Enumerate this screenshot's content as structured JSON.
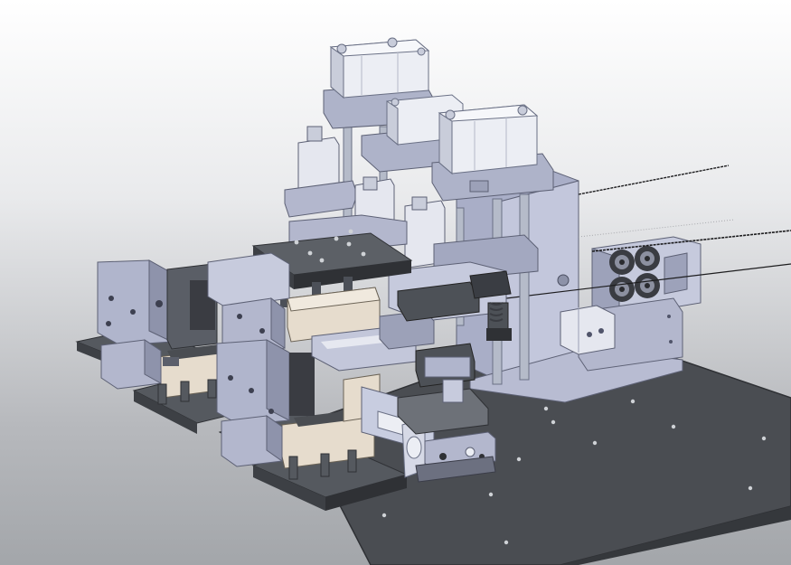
{
  "viewport": {
    "kind": "3d-cad-model-view",
    "background_top": "#ffffff",
    "background_bottom": "#a3a6aa"
  },
  "colors": {
    "base_plate": "#4a4d52",
    "base_plate_edge": "#2f3135",
    "frame_light": "#c9cde0",
    "frame_mid": "#a9aec7",
    "frame_dark": "#7f849c",
    "plate_dark": "#55595f",
    "block_cream": "#e6dccd",
    "shaft": "#b5bbc9",
    "wire": "#1d1d1f"
  }
}
